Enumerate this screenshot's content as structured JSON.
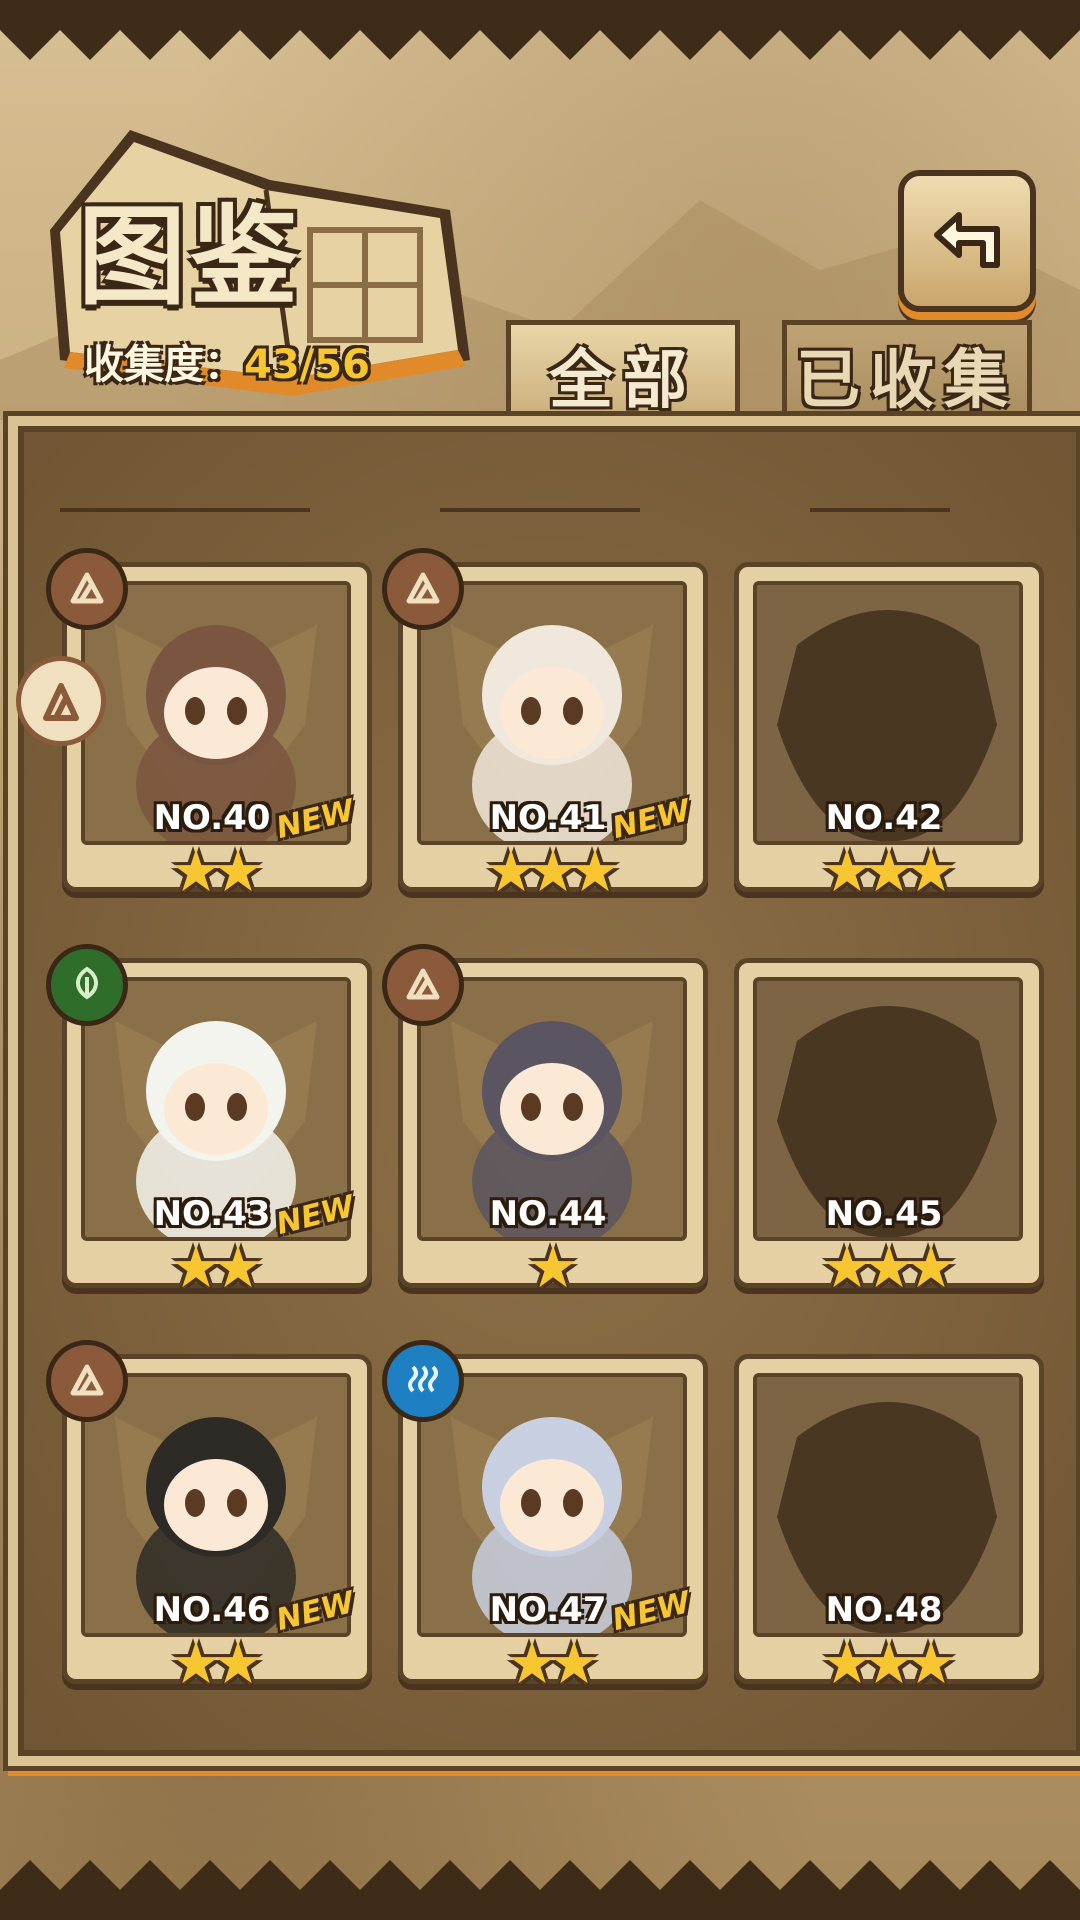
{
  "header": {
    "title": "图鉴",
    "collect_label": "收集度：",
    "collect_value": "43/56"
  },
  "tabs": [
    {
      "label": "全部",
      "active": true
    },
    {
      "label": "已收集",
      "active": false
    }
  ],
  "back_button": {
    "icon": "back-arrow-icon"
  },
  "side_badge": {
    "icon": "earth-element-icon"
  },
  "cards": [
    {
      "no": "NO.40",
      "stars": "★★",
      "new": "NEW",
      "element": "earth",
      "collected": true
    },
    {
      "no": "NO.41",
      "stars": "★★★",
      "new": "NEW",
      "element": "earth",
      "collected": true
    },
    {
      "no": "NO.42",
      "stars": "★★★",
      "new": "",
      "element": "",
      "collected": false
    },
    {
      "no": "NO.43",
      "stars": "★★",
      "new": "NEW",
      "element": "grass",
      "collected": true
    },
    {
      "no": "NO.44",
      "stars": "★",
      "new": "",
      "element": "earth",
      "collected": true
    },
    {
      "no": "NO.45",
      "stars": "★★★",
      "new": "",
      "element": "",
      "collected": false
    },
    {
      "no": "NO.46",
      "stars": "★★",
      "new": "NEW",
      "element": "earth",
      "collected": true
    },
    {
      "no": "NO.47",
      "stars": "★★",
      "new": "NEW",
      "element": "water",
      "collected": true
    },
    {
      "no": "NO.48",
      "stars": "★★★",
      "new": "",
      "element": "",
      "collected": false
    }
  ],
  "colors": {
    "accent": "#f7c631",
    "frame": "#5b4328",
    "orange_edge": "#e08a2a"
  }
}
